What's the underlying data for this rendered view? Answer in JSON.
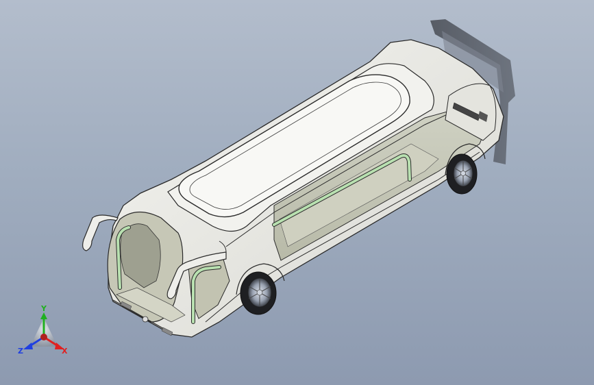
{
  "viewport": {
    "model": "bus-3d-model"
  },
  "triad": {
    "x_label": "X",
    "y_label": "Y",
    "z_label": "Z",
    "x_color": "#e02020",
    "y_color": "#20b020",
    "z_color": "#2040e0"
  },
  "colors": {
    "body_fill": "#e8e8e4",
    "body_edge": "#2a2a2a",
    "glass": "#c8c9b8",
    "rail": "#b8e0b0"
  }
}
